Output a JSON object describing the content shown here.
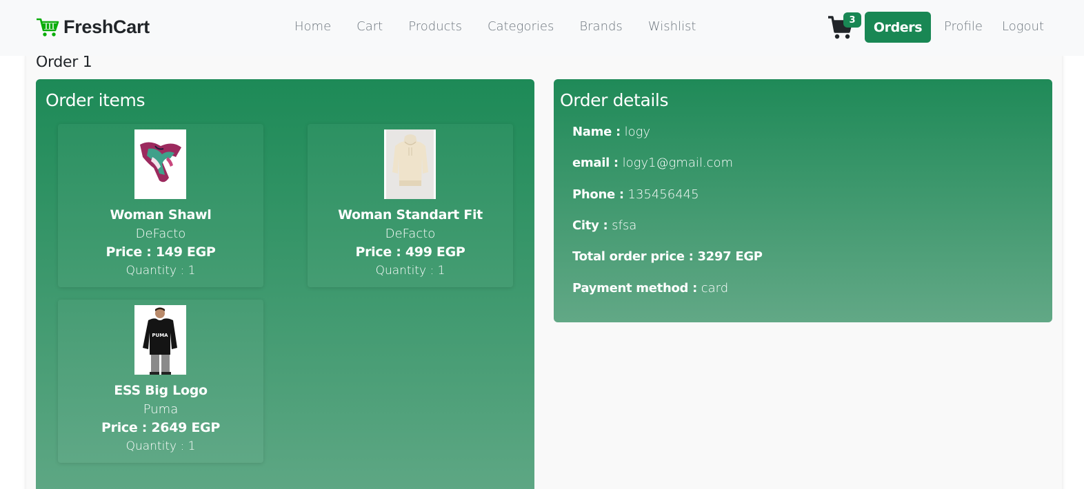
{
  "brand": {
    "name": "FreshCart",
    "icon": "cart-logo-icon",
    "color": "#0aad0a"
  },
  "nav": {
    "links": [
      "Home",
      "Cart",
      "Products",
      "Categories",
      "Brands",
      "Wishlist"
    ],
    "cart_count": "3",
    "orders_label": "Orders",
    "profile_label": "Profile",
    "logout_label": "Logout"
  },
  "order": {
    "title": "Order 1",
    "items_heading": "Order items",
    "details_heading": "Order details",
    "items": [
      {
        "title": "Woman Shawl",
        "brand": "DeFacto",
        "price": "Price : 149 EGP",
        "qty": "Quantity : 1"
      },
      {
        "title": "Woman Standart Fit",
        "brand": "DeFacto",
        "price": "Price : 499 EGP",
        "qty": "Quantity : 1"
      },
      {
        "title": "ESS Big Logo",
        "brand": "Puma",
        "price": "Price : 2649 EGP",
        "qty": "Quantity : 1"
      }
    ],
    "details": {
      "name_label": "Name :",
      "name": "logy",
      "email_label": "email :",
      "email": "logy1@gmail.com",
      "phone_label": "Phone :",
      "phone": "135456445",
      "city_label": "City :",
      "city": "sfsa",
      "total_label": "Total order price : 3297 EGP",
      "payment_label": "Payment method :",
      "payment": "card"
    }
  },
  "colors": {
    "accent": "#198754",
    "panel_top": "#1d8a57",
    "panel_bottom": "#5ea784"
  }
}
